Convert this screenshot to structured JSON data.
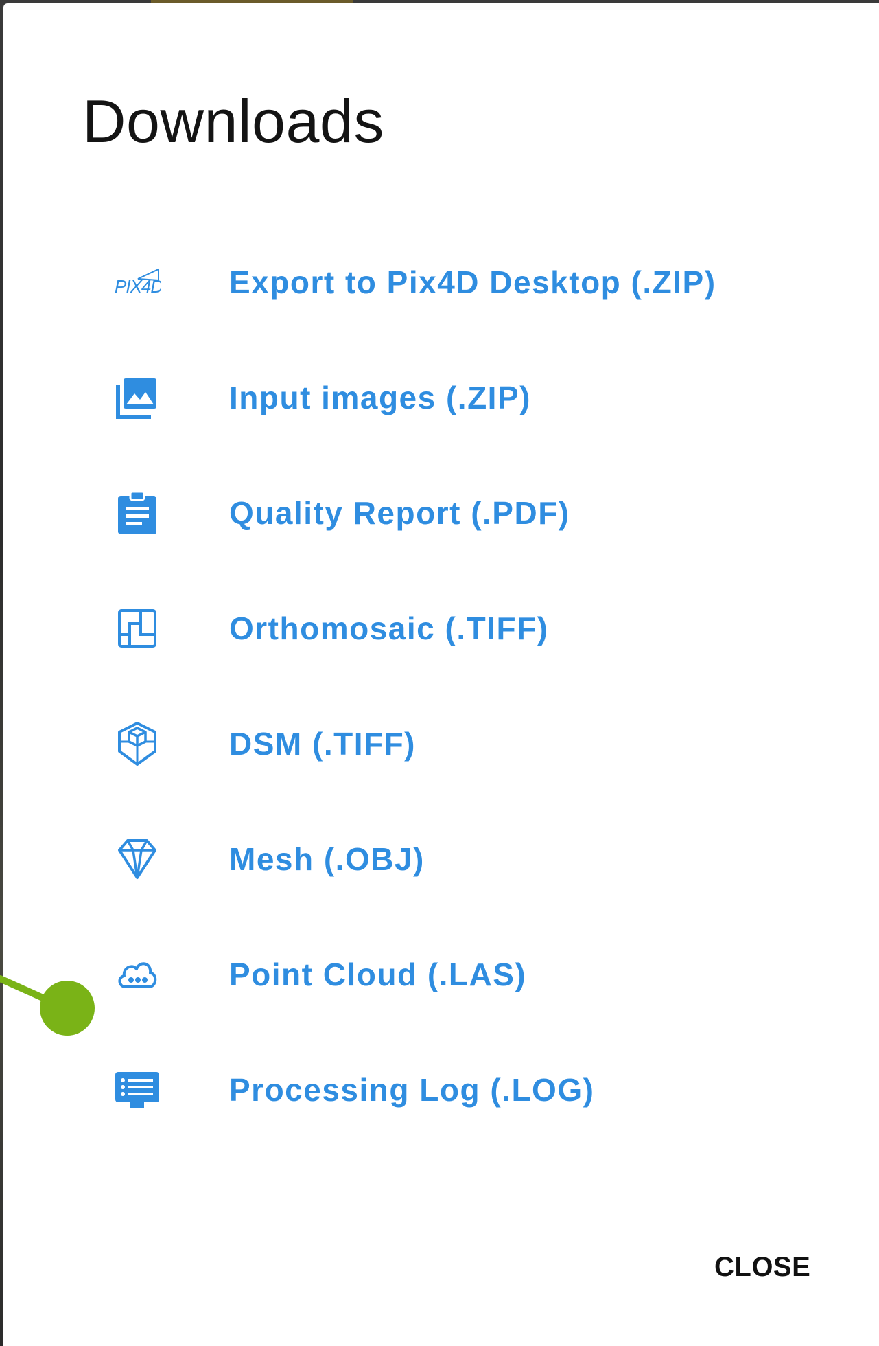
{
  "dialog": {
    "title": "Downloads",
    "close_label": "CLOSE"
  },
  "items": [
    {
      "label": "Export to Pix4D Desktop (.ZIP)",
      "icon": "pix4d-logo-icon"
    },
    {
      "label": "Input images (.ZIP)",
      "icon": "image-collection-icon"
    },
    {
      "label": "Quality Report (.PDF)",
      "icon": "clipboard-report-icon"
    },
    {
      "label": "Orthomosaic (.TIFF)",
      "icon": "orthomosaic-icon"
    },
    {
      "label": "DSM (.TIFF)",
      "icon": "dsm-cube-icon"
    },
    {
      "label": "Mesh (.OBJ)",
      "icon": "mesh-diamond-icon"
    },
    {
      "label": "Point Cloud (.LAS)",
      "icon": "point-cloud-icon"
    },
    {
      "label": "Processing Log (.LOG)",
      "icon": "processing-log-icon"
    }
  ],
  "colors": {
    "accent": "#2f8de0",
    "title": "#141414",
    "pointer": "#7ab317"
  }
}
